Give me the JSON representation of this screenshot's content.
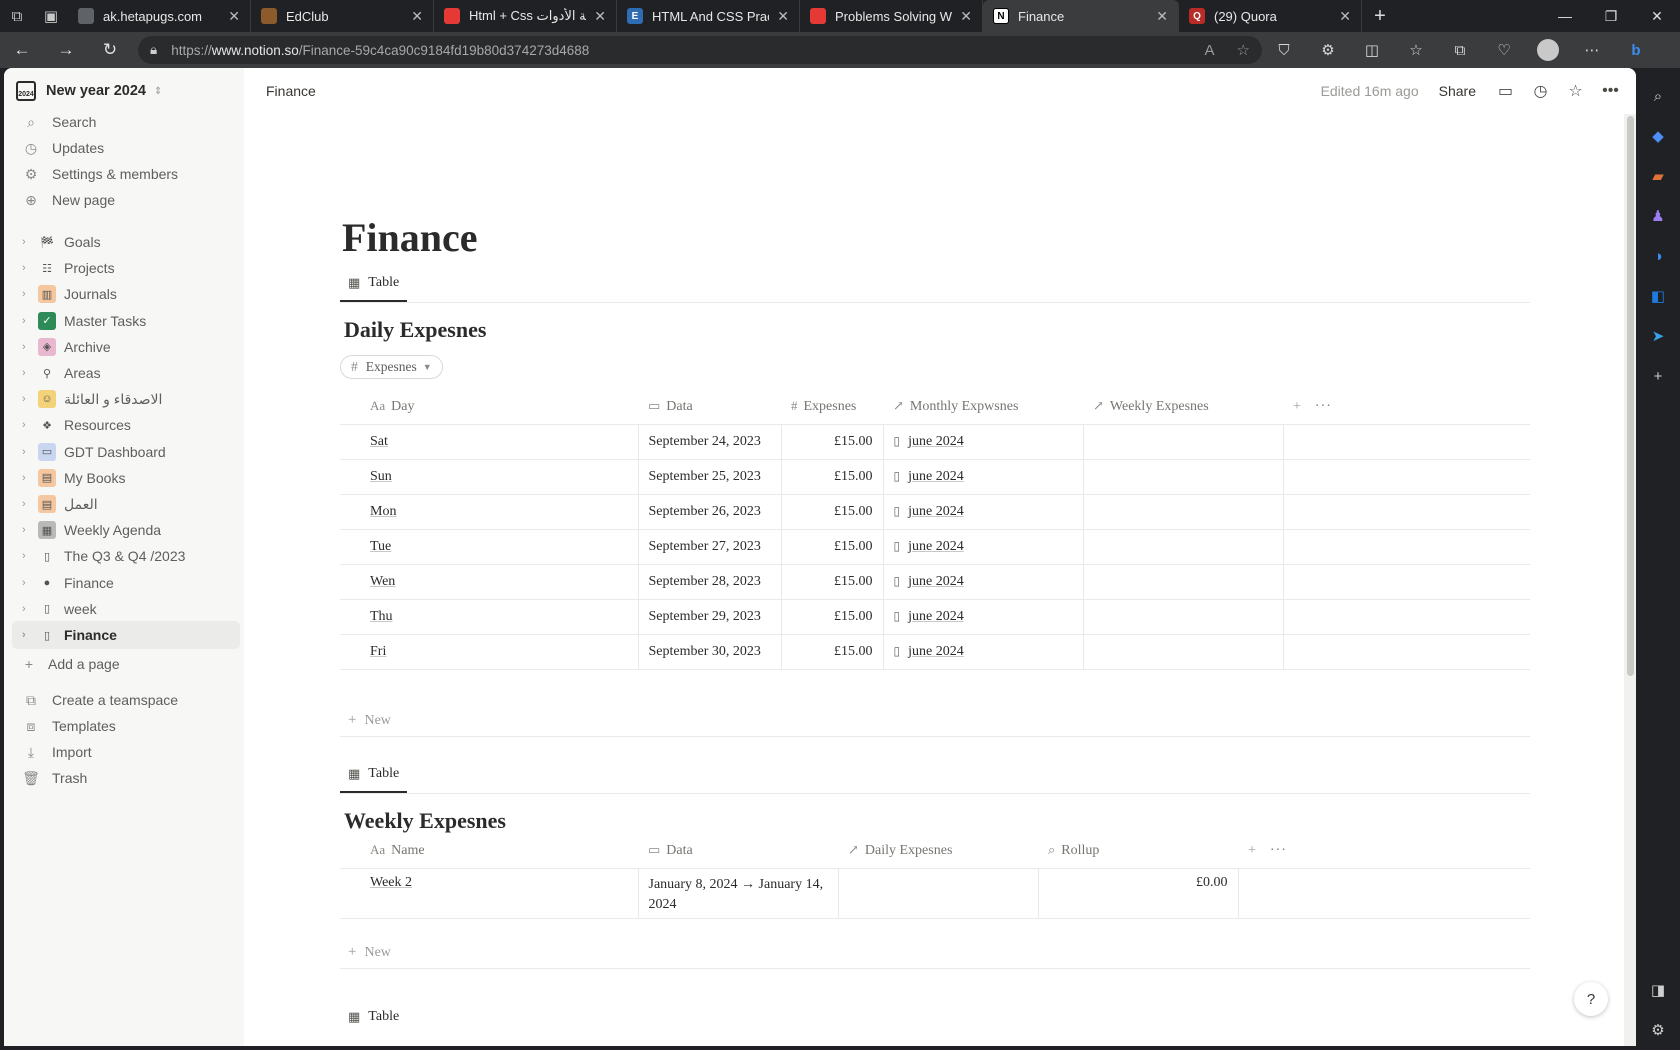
{
  "browser": {
    "tabs": [
      {
        "title": "ak.hetapugs.com",
        "favicon_color": "#5f6368",
        "favicon": "page-icon"
      },
      {
        "title": "EdClub",
        "favicon_color": "#8d5a2b",
        "favicon": "edclub-icon"
      },
      {
        "title": "Html + Css إضافة الأدوات",
        "favicon_color": "#e53935",
        "favicon": "youtube-icon"
      },
      {
        "title": "HTML And CSS Practice",
        "favicon_color": "#2e6db4",
        "favicon": "e-icon",
        "favicon_letter": "E"
      },
      {
        "title": "Problems Solving With",
        "favicon_color": "#e53935",
        "favicon": "youtube-icon"
      },
      {
        "title": "Finance",
        "favicon_color": "#ffffff",
        "favicon": "notion-icon",
        "favicon_letter": "N",
        "active": true
      },
      {
        "title": "(29) Quora",
        "favicon_color": "#b92b27",
        "favicon": "quora-icon",
        "favicon_letter": "Q"
      }
    ],
    "url_prefix": "https://",
    "url_host": "www.notion.so",
    "url_path": "/Finance-59c4ca90c9184fd19b80d374273d4688"
  },
  "workspace": {
    "name": "New year 2024",
    "icon_text": "2024"
  },
  "sidebar": {
    "top_items": [
      {
        "label": "Search",
        "icon": "search-icon",
        "glyph": "⌕"
      },
      {
        "label": "Updates",
        "icon": "clock-icon",
        "glyph": "◷"
      },
      {
        "label": "Settings & members",
        "icon": "gear-icon",
        "glyph": "⚙"
      },
      {
        "label": "New page",
        "icon": "plus-circle-icon",
        "glyph": "⊕"
      }
    ],
    "pages": [
      {
        "label": "Goals",
        "icon": "checkered-flag-icon",
        "glyph": "🏁",
        "bg": "transparent"
      },
      {
        "label": "Projects",
        "icon": "checklist-icon",
        "glyph": "☷",
        "bg": "transparent"
      },
      {
        "label": "Journals",
        "icon": "books-icon",
        "glyph": "▥",
        "bg": "#f4c7a1"
      },
      {
        "label": "Master Tasks",
        "icon": "checkbox-icon",
        "glyph": "✓",
        "bg": "#2e8b57"
      },
      {
        "label": "Archive",
        "icon": "archive-icon",
        "glyph": "◈",
        "bg": "#e8b8d0"
      },
      {
        "label": "Areas",
        "icon": "pin-icon",
        "glyph": "⚲",
        "bg": "transparent"
      },
      {
        "label": "الاصدقاء و العائلة",
        "icon": "people-icon",
        "glyph": "☺",
        "bg": "#f3d27a"
      },
      {
        "label": "Resources",
        "icon": "resources-icon",
        "glyph": "❖",
        "bg": "transparent"
      },
      {
        "label": "GDT Dashboard",
        "icon": "monitor-icon",
        "glyph": "▭",
        "bg": "#c9d6f2"
      },
      {
        "label": "My Books",
        "icon": "book-stack-icon",
        "glyph": "▤",
        "bg": "#f4c7a1"
      },
      {
        "label": "العمل",
        "icon": "book-stack-icon",
        "glyph": "▤",
        "bg": "#f4c7a1"
      },
      {
        "label": "Weekly Agenda",
        "icon": "calendar-icon",
        "glyph": "▦",
        "bg": "#b9b9b9"
      },
      {
        "label": "The Q3 & Q4 /2023",
        "icon": "page-icon",
        "glyph": "▯",
        "bg": "transparent"
      },
      {
        "label": "Finance",
        "icon": "coins-icon",
        "glyph": "●",
        "bg": "transparent"
      },
      {
        "label": "week",
        "icon": "page-icon",
        "glyph": "▯",
        "bg": "transparent"
      },
      {
        "label": "Finance",
        "icon": "page-icon",
        "glyph": "▯",
        "bg": "transparent",
        "selected": true
      }
    ],
    "add_page": "Add a page",
    "bottom_items": [
      {
        "label": "Create a teamspace",
        "icon": "teamspace-icon",
        "glyph": "⧉"
      },
      {
        "label": "Templates",
        "icon": "templates-icon",
        "glyph": "⧈"
      },
      {
        "label": "Import",
        "icon": "download-icon",
        "glyph": "⤓"
      },
      {
        "label": "Trash",
        "icon": "trash-icon",
        "glyph": "🗑"
      }
    ]
  },
  "topbar": {
    "breadcrumb": "Finance",
    "edited": "Edited 16m ago",
    "share": "Share"
  },
  "page": {
    "title": "Finance",
    "view_label": "Table",
    "daily": {
      "title": "Daily Expesnes",
      "filter_label": "Expesnes",
      "columns": [
        "Day",
        "Data",
        "Expesnes",
        "Monthly Expwsnes",
        "Weekly Expesnes"
      ],
      "rows": [
        {
          "day": "Sat",
          "date": "September 24, 2023",
          "amount": "£15.00",
          "monthly": "june 2024"
        },
        {
          "day": "Sun",
          "date": "September 25, 2023",
          "amount": "£15.00",
          "monthly": "june 2024"
        },
        {
          "day": "Mon",
          "date": "September 26, 2023",
          "amount": "£15.00",
          "monthly": "june 2024"
        },
        {
          "day": "Tue",
          "date": "September 27, 2023",
          "amount": "£15.00",
          "monthly": "june 2024"
        },
        {
          "day": "Wen",
          "date": "September 28, 2023",
          "amount": "£15.00",
          "monthly": "june 2024"
        },
        {
          "day": "Thu",
          "date": "September 29, 2023",
          "amount": "£15.00",
          "monthly": "june 2024"
        },
        {
          "day": "Fri",
          "date": "September 30, 2023",
          "amount": "£15.00",
          "monthly": "june 2024"
        }
      ],
      "new_label": "New"
    },
    "weekly": {
      "title": "Weekly Expesnes",
      "columns": [
        "Name",
        "Data",
        "Daily Expesnes",
        "Rollup"
      ],
      "rows": [
        {
          "name": "Week 2",
          "date": "January 8, 2024 → January 14, 2024",
          "daily": "",
          "rollup": "£0.00"
        }
      ],
      "new_label": "New"
    },
    "third_view_label": "Table"
  },
  "help": "?"
}
